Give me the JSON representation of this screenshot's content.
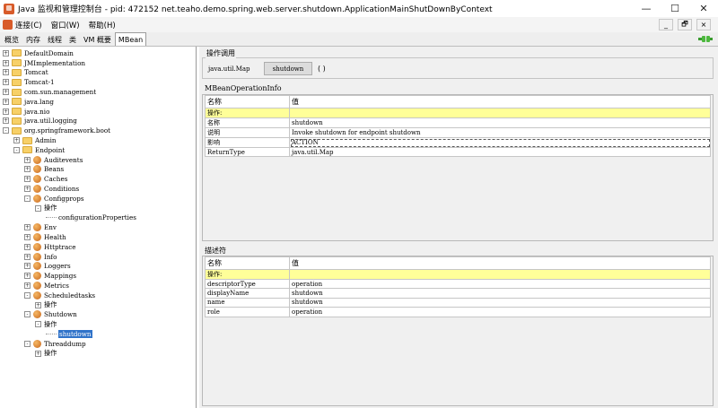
{
  "window": {
    "title": "Java 监视和管理控制台 - pid: 472152 net.teaho.demo.spring.web.server.shutdown.ApplicationMainShutDownByContext",
    "minimize_glyph": "—",
    "maximize_glyph": "☐",
    "close_glyph": "✕"
  },
  "menu": {
    "items": [
      "连接(C)",
      "窗口(W)",
      "帮助(H)"
    ],
    "inner_minimize": "_",
    "inner_restore": "🗗",
    "inner_close": "×"
  },
  "tabs": [
    "概览",
    "内存",
    "线程",
    "类",
    "VM 概要",
    "MBean"
  ],
  "active_tab": "MBean",
  "tree": {
    "nodes": [
      {
        "label": "DefaultDomain",
        "level": 0,
        "icon": "folder",
        "toggle": "+"
      },
      {
        "label": "JMImplementation",
        "level": 0,
        "icon": "folder",
        "toggle": "+"
      },
      {
        "label": "Tomcat",
        "level": 0,
        "icon": "folder",
        "toggle": "+"
      },
      {
        "label": "Tomcat-1",
        "level": 0,
        "icon": "folder",
        "toggle": "+"
      },
      {
        "label": "com.sun.management",
        "level": 0,
        "icon": "folder",
        "toggle": "+"
      },
      {
        "label": "java.lang",
        "level": 0,
        "icon": "folder",
        "toggle": "+"
      },
      {
        "label": "java.nio",
        "level": 0,
        "icon": "folder",
        "toggle": "+"
      },
      {
        "label": "java.util.logging",
        "level": 0,
        "icon": "folder",
        "toggle": "+"
      },
      {
        "label": "org.springframework.boot",
        "level": 0,
        "icon": "folder",
        "toggle": "-"
      },
      {
        "label": "Admin",
        "level": 1,
        "icon": "folder",
        "toggle": "+"
      },
      {
        "label": "Endpoint",
        "level": 1,
        "icon": "folder",
        "toggle": "-"
      },
      {
        "label": "Auditevents",
        "level": 2,
        "icon": "bean",
        "toggle": "+"
      },
      {
        "label": "Beans",
        "level": 2,
        "icon": "bean",
        "toggle": "+"
      },
      {
        "label": "Caches",
        "level": 2,
        "icon": "bean",
        "toggle": "+"
      },
      {
        "label": "Conditions",
        "level": 2,
        "icon": "bean",
        "toggle": "+"
      },
      {
        "label": "Configprops",
        "level": 2,
        "icon": "bean",
        "toggle": "-"
      },
      {
        "label": "操作",
        "level": 3,
        "icon": "none",
        "toggle": "-"
      },
      {
        "label": "configurationProperties",
        "level": 4,
        "icon": "none",
        "toggle": ""
      },
      {
        "label": "Env",
        "level": 2,
        "icon": "bean",
        "toggle": "+"
      },
      {
        "label": "Health",
        "level": 2,
        "icon": "bean",
        "toggle": "+"
      },
      {
        "label": "Httptrace",
        "level": 2,
        "icon": "bean",
        "toggle": "+"
      },
      {
        "label": "Info",
        "level": 2,
        "icon": "bean",
        "toggle": "+"
      },
      {
        "label": "Loggers",
        "level": 2,
        "icon": "bean",
        "toggle": "+"
      },
      {
        "label": "Mappings",
        "level": 2,
        "icon": "bean",
        "toggle": "+"
      },
      {
        "label": "Metrics",
        "level": 2,
        "icon": "bean",
        "toggle": "+"
      },
      {
        "label": "Scheduledtasks",
        "level": 2,
        "icon": "bean",
        "toggle": "-"
      },
      {
        "label": "操作",
        "level": 3,
        "icon": "none",
        "toggle": "+"
      },
      {
        "label": "Shutdown",
        "level": 2,
        "icon": "bean",
        "toggle": "-"
      },
      {
        "label": "操作",
        "level": 3,
        "icon": "none",
        "toggle": "-"
      },
      {
        "label": "shutdown",
        "level": 4,
        "icon": "none",
        "toggle": "",
        "selected": true
      },
      {
        "label": "Threaddump",
        "level": 2,
        "icon": "bean",
        "toggle": "-"
      },
      {
        "label": "操作",
        "level": 3,
        "icon": "none",
        "toggle": "+"
      }
    ]
  },
  "operation": {
    "section_title": "操作调用",
    "return_type": "java.util.Map",
    "button_label": "shutdown",
    "parens": "( )"
  },
  "mbean_info": {
    "section_title": "MBeanOperationInfo",
    "headers": [
      "名称",
      "值"
    ],
    "rows": [
      {
        "name": "操作:",
        "value": "",
        "highlight": true
      },
      {
        "name": "名称",
        "value": "shutdown"
      },
      {
        "name": "说明",
        "value": "Invoke shutdown for endpoint shutdown"
      },
      {
        "name": "影响",
        "value": "ACTION",
        "focus": true
      },
      {
        "name": "ReturnType",
        "value": "java.util.Map"
      }
    ]
  },
  "descriptor": {
    "section_title": "描述符",
    "headers": [
      "名称",
      "值"
    ],
    "rows": [
      {
        "name": "操作:",
        "value": "",
        "highlight": true
      },
      {
        "name": "descriptorType",
        "value": "operation"
      },
      {
        "name": "displayName",
        "value": "shutdown"
      },
      {
        "name": "name",
        "value": "shutdown"
      },
      {
        "name": "role",
        "value": "operation"
      }
    ]
  },
  "colors": {
    "highlight_row": "#ffff99",
    "selection": "#3073c9",
    "folder": "#f7d068",
    "bean": "#e08a3c"
  }
}
